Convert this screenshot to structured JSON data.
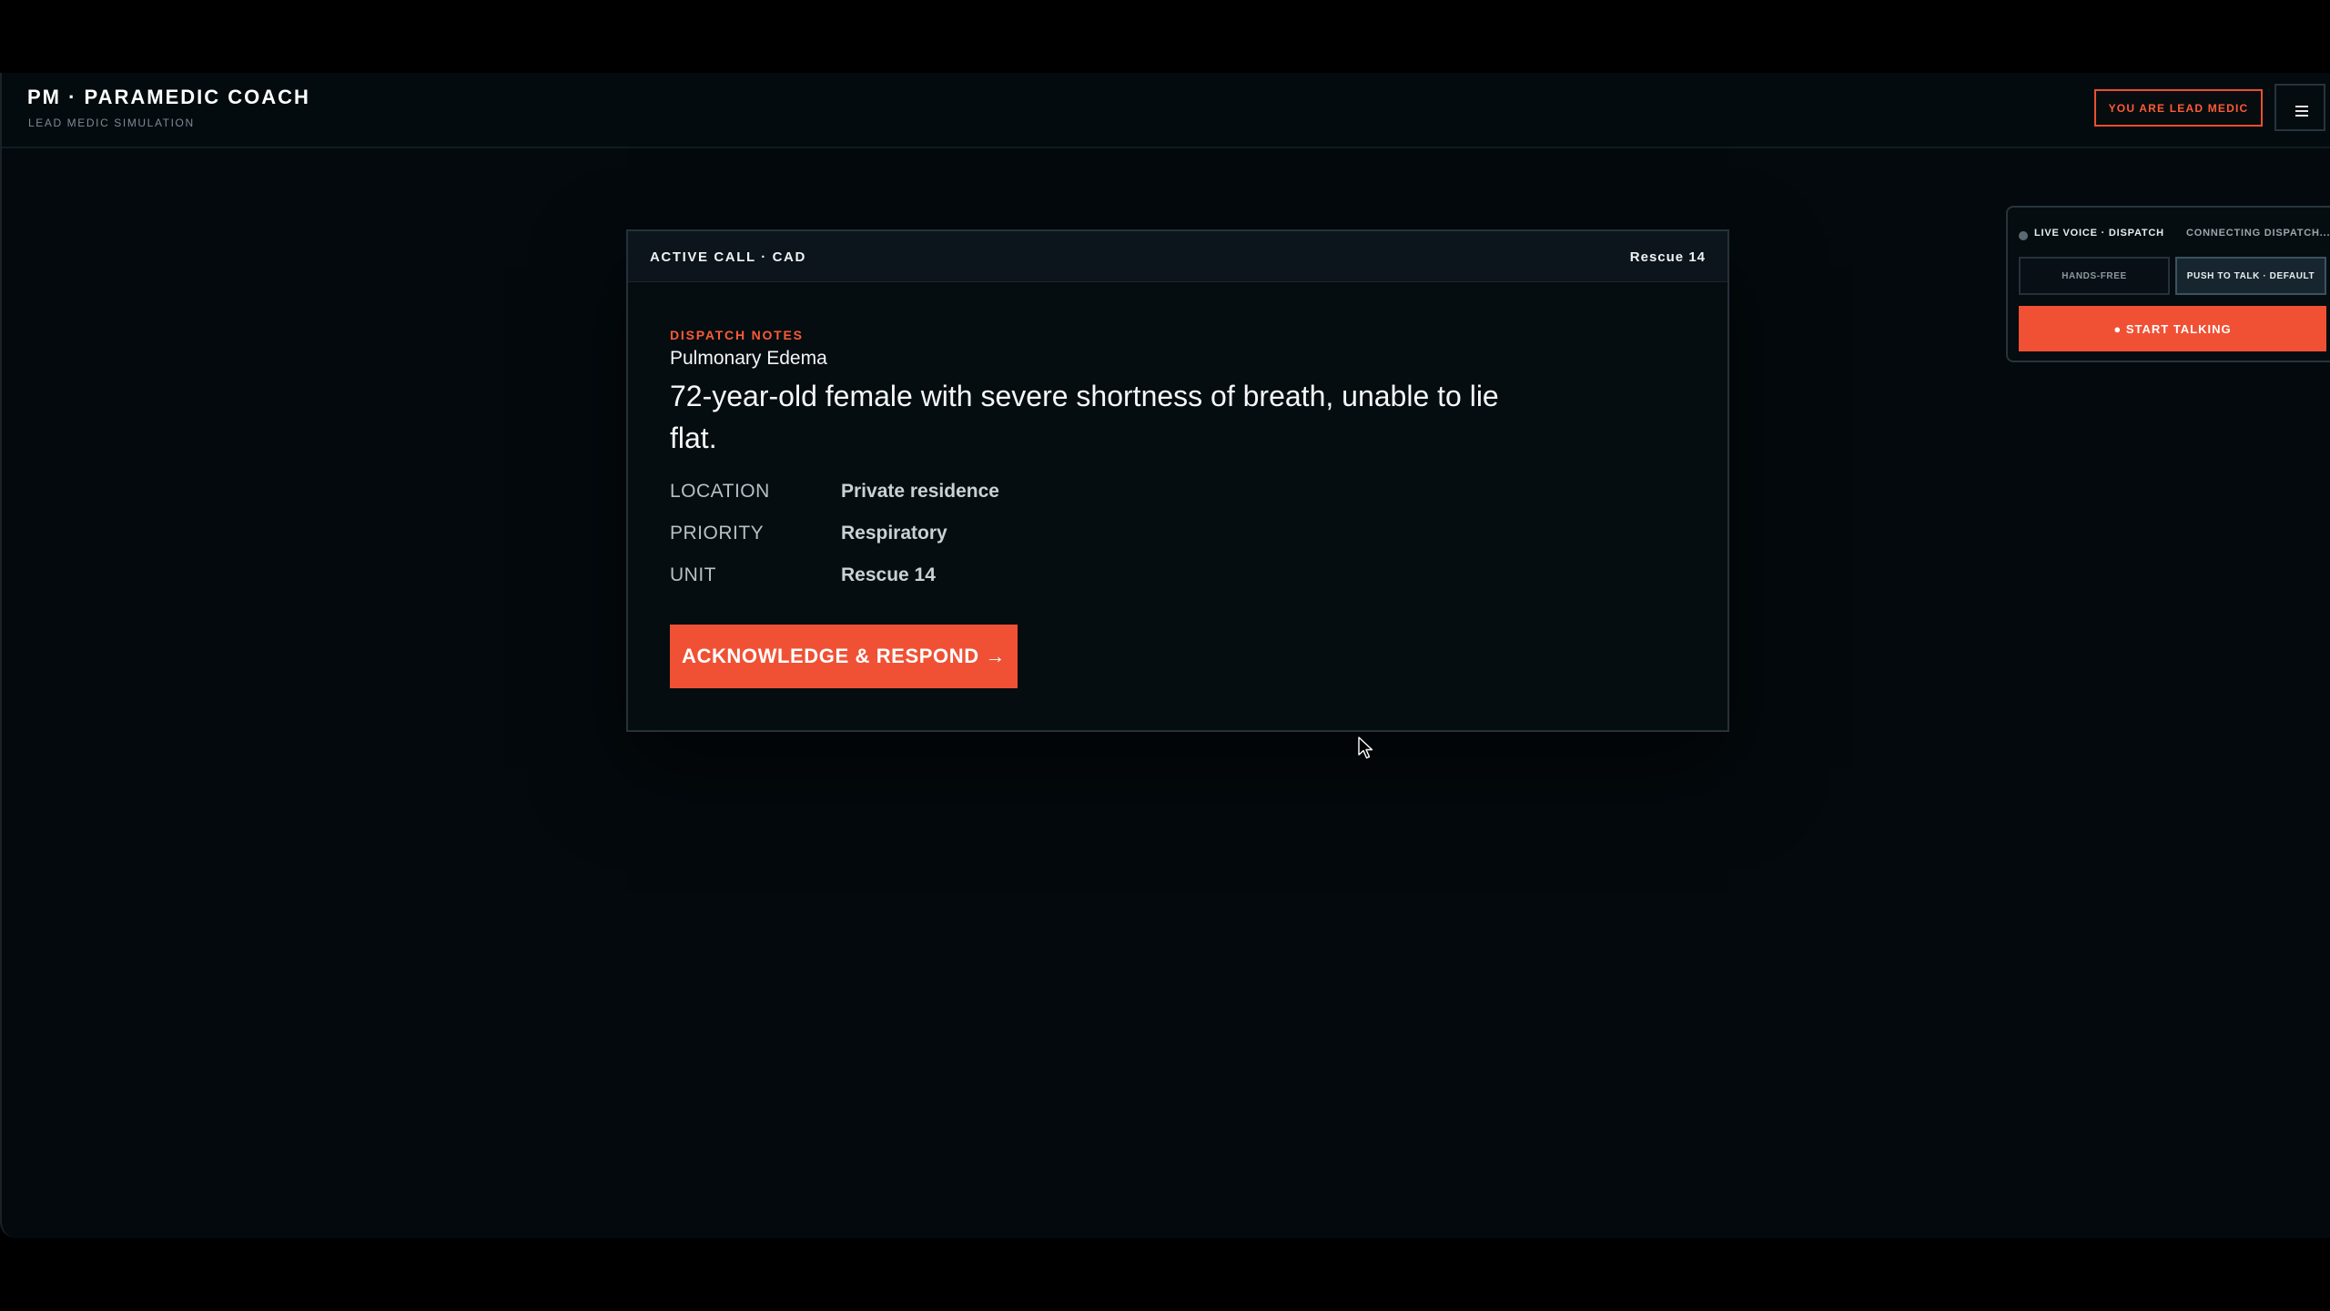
{
  "header": {
    "title": "PM · PARAMEDIC COACH",
    "subtitle": "LEAD MEDIC SIMULATION",
    "role_badge": "YOU ARE LEAD MEDIC",
    "menu_icon": "hamburger-icon"
  },
  "card": {
    "header_left": "ACTIVE CALL · CAD",
    "header_right": "Rescue 14",
    "notes_label": "DISPATCH NOTES",
    "call_type": "Pulmonary Edema",
    "description": "72-year-old female with severe shortness of breath, unable to lie flat.",
    "details": [
      {
        "label": "LOCATION",
        "value": "Private residence"
      },
      {
        "label": "PRIORITY",
        "value": "Respiratory"
      },
      {
        "label": "UNIT",
        "value": "Rescue 14"
      }
    ],
    "action_label": "ACKNOWLEDGE & RESPOND →"
  },
  "voice": {
    "title": "LIVE VOICE · DISPATCH",
    "status": "CONNECTING DISPATCH...",
    "mode_handsfree": "HANDS-FREE",
    "mode_ptt": "PUSH TO TALK · DEFAULT",
    "talk_label": "● START TALKING"
  },
  "colors": {
    "accent": "#f05134",
    "background": "#03090d",
    "panel": "#050d11"
  }
}
